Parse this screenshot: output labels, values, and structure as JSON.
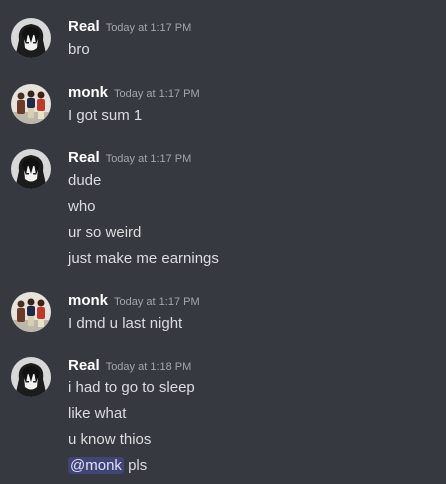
{
  "colors": {
    "background": "#36393f",
    "username": "#ffffff",
    "timestamp": "#a3a6aa",
    "message_text": "#dcddde",
    "mention_bg": "#5865f24d",
    "mention_text": "#dee0fc"
  },
  "messages": [
    {
      "author": "Real",
      "avatar": "anime-dark-hair-avatar",
      "time": "Today at 1:17 PM",
      "lines": [
        "bro"
      ]
    },
    {
      "author": "monk",
      "avatar": "group-photo-avatar",
      "time": "Today at 1:17 PM",
      "lines": [
        "I got sum 1"
      ]
    },
    {
      "author": "Real",
      "avatar": "anime-dark-hair-avatar",
      "time": "Today at 1:17 PM",
      "lines": [
        "dude",
        "who",
        "ur so weird",
        "just make me earnings"
      ]
    },
    {
      "author": "monk",
      "avatar": "group-photo-avatar",
      "time": "Today at 1:17 PM",
      "lines": [
        "I dmd u last night"
      ]
    },
    {
      "author": "Real",
      "avatar": "anime-dark-hair-avatar",
      "time": "Today at 1:18 PM",
      "lines": [
        "i had to go to sleep",
        "like what",
        "u know thios"
      ],
      "mention_line": {
        "mention": "@monk",
        "text": " pls"
      }
    }
  ]
}
